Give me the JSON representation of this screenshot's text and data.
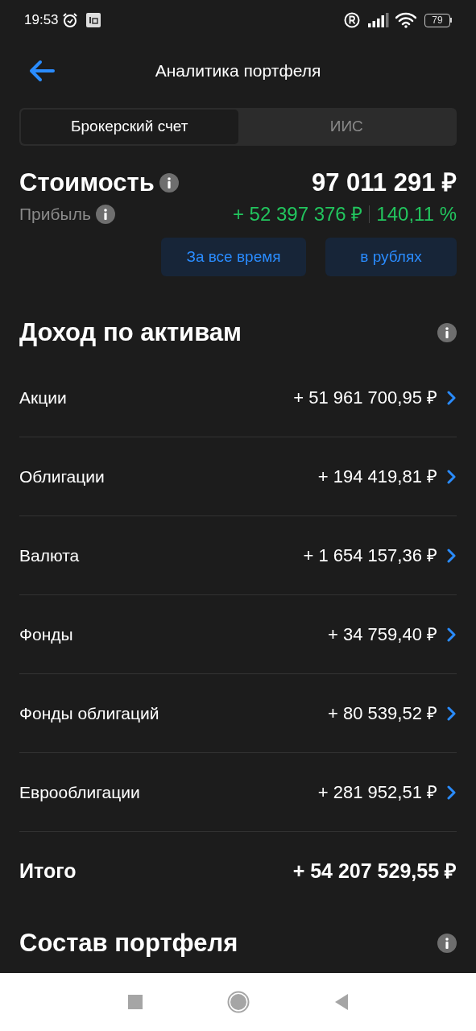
{
  "status_bar": {
    "time": "19:53",
    "battery": "79"
  },
  "header": {
    "title": "Аналитика портфеля"
  },
  "tabs": [
    {
      "label": "Брокерский счет",
      "selected": true
    },
    {
      "label": "ИИС",
      "selected": false
    }
  ],
  "summary": {
    "value_label": "Стоимость",
    "value": "97 011 291 ₽",
    "profit_label": "Прибыль",
    "profit": "+ 52 397 376 ₽",
    "profit_percent": "140,11 %"
  },
  "filters": [
    "За все время",
    "в рублях"
  ],
  "income": {
    "title": "Доход по активам",
    "rows": [
      {
        "label": "Акции",
        "value": "+ 51 961 700,95 ₽",
        "kind": "link"
      },
      {
        "label": "Облигации",
        "value": "+ 194 419,81 ₽",
        "kind": "link"
      },
      {
        "label": "Валюта",
        "value": "+ 1 654 157,36 ₽",
        "kind": "link"
      },
      {
        "label": "Фонды",
        "value": "+ 34 759,40 ₽",
        "kind": "link"
      },
      {
        "label": "Фонды облигаций",
        "value": "+ 80 539,52 ₽",
        "kind": "link"
      },
      {
        "label": "Еврооблигации",
        "value": "+ 281 952,51 ₽",
        "kind": "link"
      },
      {
        "label": "Итого",
        "value": "+ 54 207 529,55 ₽",
        "kind": "total"
      }
    ]
  },
  "composition": {
    "title": "Состав портфеля"
  }
}
